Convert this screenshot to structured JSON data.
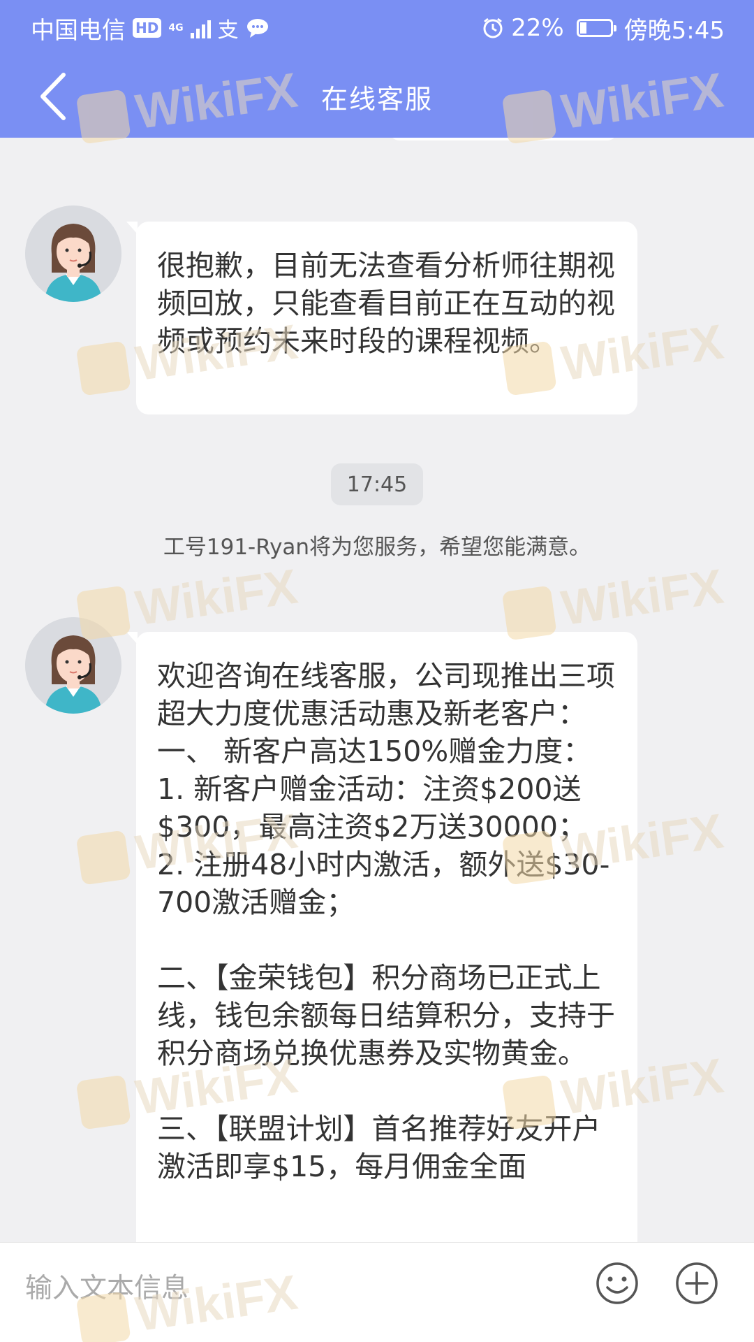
{
  "status_bar": {
    "carrier": "中国电信",
    "hd_badge": "HD",
    "network": "4G",
    "battery_percent": "22%",
    "time": "傍晚5:45",
    "battery_level": 0.22
  },
  "nav": {
    "title": "在线客服"
  },
  "messages": [
    {
      "sender": "agent",
      "text": "很抱歉，目前无法查看分析师往期视频回放，只能查看目前正在互动的视频或预约未来时段的课程视频。"
    },
    {
      "sender": "agent",
      "text": "欢迎咨询在线客服，公司现推出三项超大力度优惠活动惠及新老客户：\n一、 新客户高达150%赠金力度：\n1. 新客户赠金活动：注资$200送$300，最高注资$2万送30000；\n2. 注册48小时内激活，额外送$30-700激活赠金；\n\n二、【金荣钱包】积分商场已正式上线，钱包余额每日结算积分，支持于积分商场兑换优惠券及实物黄金。\n\n三、【联盟计划】首名推荐好友开户激活即享$15，每月佣金全面"
    }
  ],
  "timestamp": "17:45",
  "system_message": "工号191-Ryan将为您服务，希望您能满意。",
  "input": {
    "placeholder": "输入文本信息",
    "value": ""
  },
  "icons": {
    "back": "chevron-left-icon",
    "emoji": "smiley-icon",
    "add": "plus-circle-icon"
  },
  "watermark": "WikiFX",
  "colors": {
    "header": "#7a8ff3",
    "background": "#f0f0f2",
    "bubble": "#ffffff"
  }
}
